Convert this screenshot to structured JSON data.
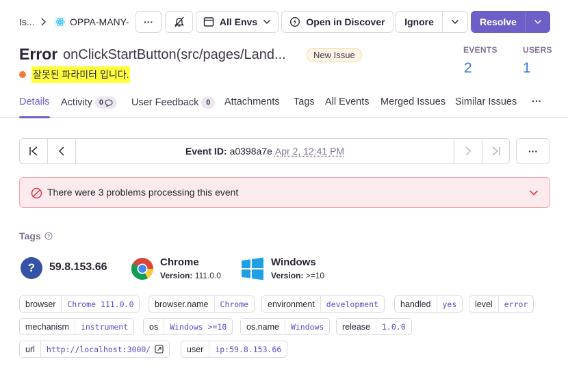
{
  "breadcrumb": {
    "parent": "Is...",
    "project": "OPPA-MANY-"
  },
  "header": {
    "more_label": "···",
    "envs_label": "All Envs",
    "discover_label": "Open in Discover",
    "ignore_label": "Ignore",
    "resolve_label": "Resolve"
  },
  "issue": {
    "type": "Error",
    "culprit": "onClickStartButton(src/pages/Land...",
    "badge": "New Issue",
    "message": "잘못된 파라미터 입니다."
  },
  "stats": {
    "events_label": "EVENTS",
    "events_value": "2",
    "users_label": "USERS",
    "users_value": "1"
  },
  "tabs": [
    {
      "label": "Details"
    },
    {
      "label": "Activity",
      "count": "0"
    },
    {
      "label": "User Feedback",
      "count": "0"
    },
    {
      "label": "Attachments"
    },
    {
      "label": "Tags"
    },
    {
      "label": "All Events"
    },
    {
      "label": "Merged Issues"
    },
    {
      "label": "Similar Issues"
    },
    {
      "label": "···"
    }
  ],
  "event": {
    "id_label": "Event ID:",
    "id": "a0398a7e",
    "date": "Apr 2, 12:41 PM",
    "more_label": "···"
  },
  "alert": {
    "text": "There were 3 problems processing this event"
  },
  "tags_section": {
    "title": "Tags",
    "user_icon_label": "?",
    "ip": "59.8.153.66",
    "browser": {
      "name": "Chrome",
      "version_label": "Version:",
      "version": "111.0.0"
    },
    "os": {
      "name": "Windows",
      "version_label": "Version:",
      "version": ">=10"
    }
  },
  "tags": [
    {
      "key": "browser",
      "value": "Chrome 111.0.0"
    },
    {
      "key": "browser.name",
      "value": "Chrome"
    },
    {
      "key": "environment",
      "value": "development"
    },
    {
      "key": "handled",
      "value": "yes"
    },
    {
      "key": "level",
      "value": "error"
    },
    {
      "key": "mechanism",
      "value": "instrument"
    },
    {
      "key": "os",
      "value": "Windows >=10"
    },
    {
      "key": "os.name",
      "value": "Windows"
    },
    {
      "key": "release",
      "value": "1.0.0"
    },
    {
      "key": "url",
      "value": "http://localhost:3000/"
    },
    {
      "key": "user",
      "value": "ip:59.8.153.66"
    }
  ],
  "colors": {
    "accent": "#6c5fc7",
    "link": "#3d74db",
    "error_dot": "#f07b3a",
    "highlight": "#ffff3c"
  }
}
